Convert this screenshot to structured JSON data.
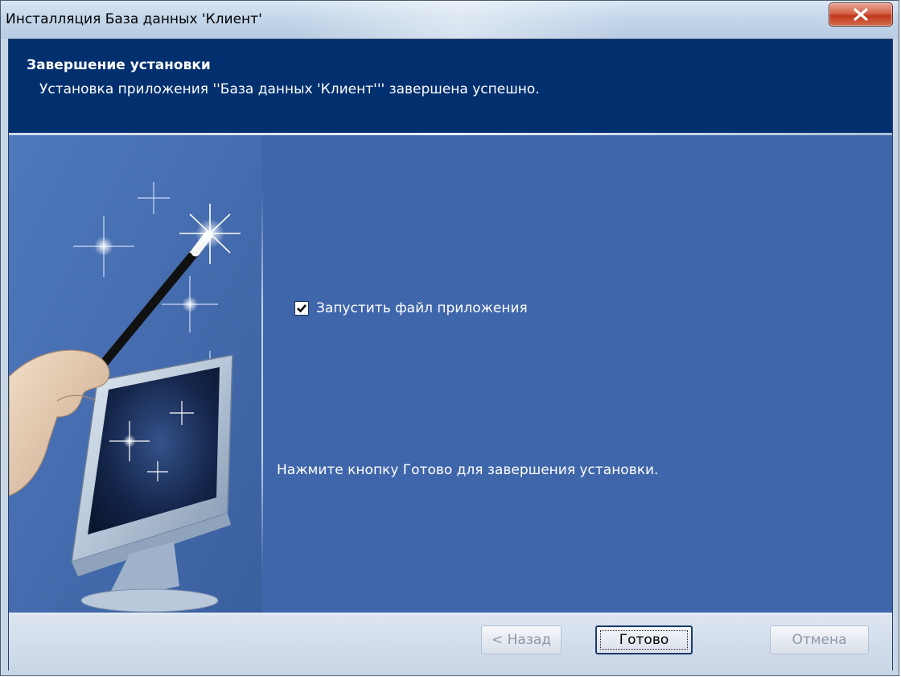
{
  "window": {
    "title": "Инсталляция База данных 'Клиент'"
  },
  "header": {
    "title": "Завершение установки",
    "subtitle": "Установка приложения ''База данных 'Клиент''' завершена успешно."
  },
  "content": {
    "run_checkbox": {
      "label": "Запустить файл приложения",
      "checked": true
    },
    "finish_instruction": "Нажмите кнопку Готово для завершения установки."
  },
  "buttons": {
    "back": "< Назад",
    "finish": "Готово",
    "cancel": "Отмена"
  },
  "icons": {
    "close": "close-x-icon",
    "checkmark": "checkmark-icon",
    "illustration": "wizard-wand-monitor-illustration"
  },
  "colors": {
    "header_bg": "#02306f",
    "body_bg": "#3f66aa",
    "close_button": "#c2381c"
  }
}
